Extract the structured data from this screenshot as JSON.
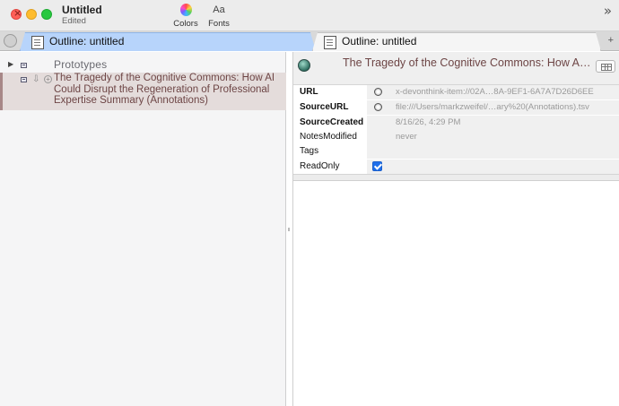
{
  "window": {
    "title": "Untitled",
    "subtitle": "Edited"
  },
  "toolbar": {
    "colors_label": "Colors",
    "fonts_label": "Fonts",
    "fonts_glyph": "Aa",
    "overflow_glyph": "»"
  },
  "tabs": [
    {
      "label": "Outline: untitled"
    },
    {
      "label": "Outline: untitled"
    }
  ],
  "tab_plus": "+",
  "outline": {
    "prototypes_label": "Prototypes",
    "note_title": "The Tragedy of the Cognitive Commons: How AI Could Disrupt the Regeneration of Professional Expertise Summary (Annotations)"
  },
  "right": {
    "header_title": "The Tragedy of the Cognitive Commons: How AI Co...",
    "attributes": [
      {
        "key": "URL",
        "value": "x-devonthink-item://02A…8A-9EF1-6A7A7D26D6EE"
      },
      {
        "key": "SourceURL",
        "value": "file:///Users/markzweifel/…ary%20(Annotations).tsv"
      },
      {
        "key": "SourceCreated",
        "value": "8/16/26, 4:29 PM"
      },
      {
        "key": "NotesModified",
        "value": "never"
      },
      {
        "key": "Tags",
        "value": ""
      },
      {
        "key": "ReadOnly",
        "value": ""
      }
    ]
  },
  "colors": {
    "selected_tab": "#b7d4fb",
    "note_text": "#6d4545",
    "checkbox": "#1f6fea"
  }
}
